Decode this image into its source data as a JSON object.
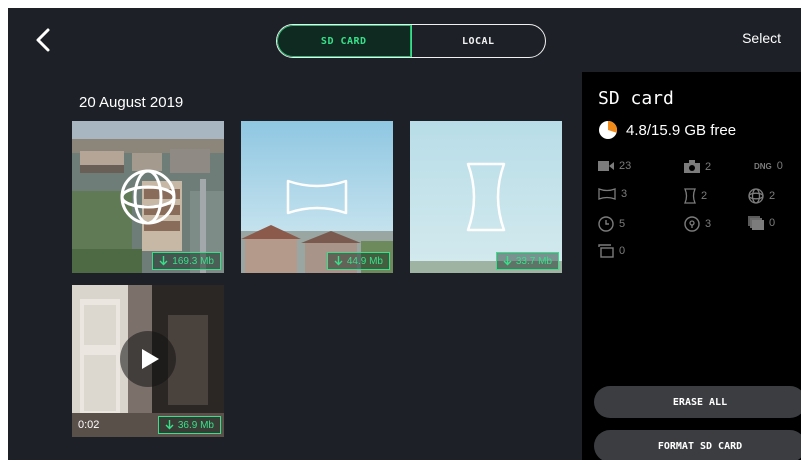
{
  "topbar": {
    "tabs": [
      {
        "label": "SD CARD",
        "active": true
      },
      {
        "label": "LOCAL",
        "active": false
      }
    ],
    "select_label": "Select"
  },
  "gallery": {
    "date": "20 August 2019",
    "items": [
      {
        "kind": "sphere-photo",
        "icon": "sphere-icon",
        "size": "169.3 Mb"
      },
      {
        "kind": "panorama-photo",
        "icon": "panorama-icon",
        "size": "44.9 Mb"
      },
      {
        "kind": "vertical-panorama-photo",
        "icon": "vertical-panorama-icon",
        "size": "33.7 Mb"
      },
      {
        "kind": "video",
        "icon": "play-icon",
        "duration": "0:02",
        "size": "36.9 Mb"
      }
    ]
  },
  "panel": {
    "title": "SD card",
    "storage_text": "4.8/15.9 GB free",
    "storage_used_fraction": 0.3,
    "stats": {
      "video": "23",
      "photo": "2",
      "dng_label": "DNG",
      "dng": "0",
      "panorama": "3",
      "vertical_panorama": "2",
      "sphere": "2",
      "timelapse": "5",
      "hyperlapse": "3",
      "burst": "0",
      "bracket": "0"
    },
    "erase_label": "ERASE ALL",
    "format_label": "FORMAT SD CARD"
  },
  "colors": {
    "background": "#1d2127",
    "panel": "#000000",
    "accent_green": "#38e08a",
    "storage_orange": "#f28a1a",
    "button_gray": "#3b3d40"
  }
}
